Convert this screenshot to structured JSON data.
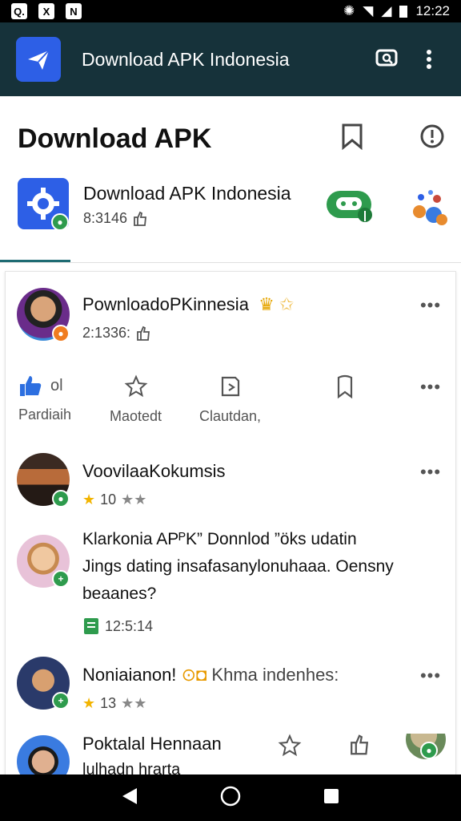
{
  "status_bar": {
    "left_icons": [
      "Q.",
      "X",
      "N"
    ],
    "time": "12:22"
  },
  "app_bar": {
    "title": "Download APK Indonesia",
    "logo_icon": "paper-plane-icon",
    "actions": [
      "chat-icon",
      "more-vert-icon"
    ]
  },
  "header": {
    "title": "Download APK",
    "featured": {
      "name": "Download APK Indonesia",
      "meta": "8:3146"
    }
  },
  "posts": [
    {
      "name": "PownloadoPKinnesia",
      "meta": "2:1336:",
      "actions": [
        {
          "label": "Pardiaih",
          "count": "ol",
          "icon": "thumbs-up-icon"
        },
        {
          "label": "Maotedt",
          "icon": "star-icon"
        },
        {
          "label": "Clautdan,",
          "icon": "share-icon"
        },
        {
          "label": "",
          "icon": "bookmark-icon"
        }
      ]
    },
    {
      "name": "VoovilaaKokumsis",
      "rating": "10"
    },
    {
      "name": "Klarkonia APᴾK” Donnlod ”öks udatin",
      "line2": "Jings dating insafasanylonuhaaa. Oensny",
      "line3": "beaanes?",
      "meta": "12:5:14"
    },
    {
      "name": "Noniaianon!",
      "extra": "Khma indenhes:",
      "rating": "13"
    },
    {
      "name": "Poktalal Hennaan",
      "line2": "lulhadn hrarta"
    }
  ],
  "colors": {
    "appbar": "#16323a",
    "brand_blue": "#2d5fe6",
    "green": "#2e9b4d",
    "star": "#f2b400"
  }
}
